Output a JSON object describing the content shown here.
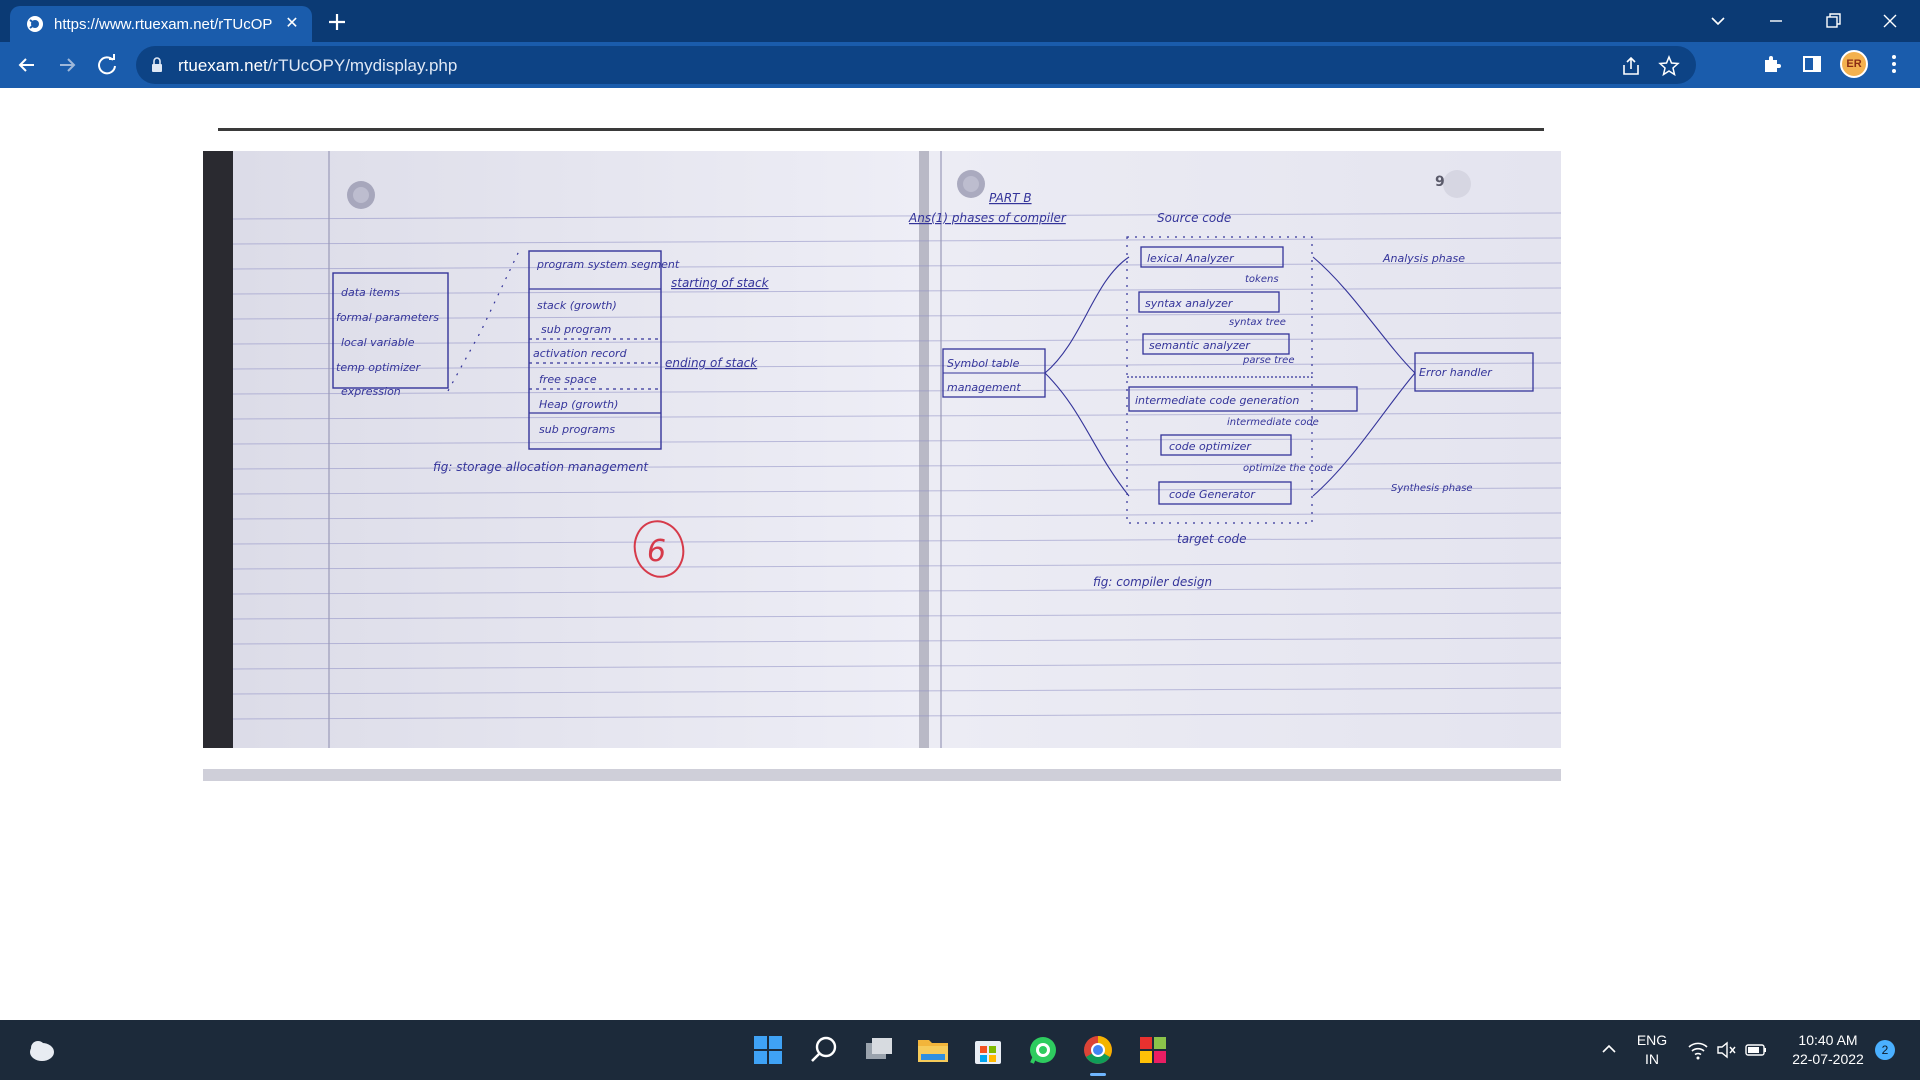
{
  "browser": {
    "tab": {
      "title": "https://www.rtuexam.net/rTUcOP",
      "close": "✕"
    },
    "address": {
      "host": "rtuexam.net",
      "path": "/rTUcOPY/mydisplay.php"
    }
  },
  "page": {
    "left_page": {
      "labels": {
        "left_box": [
          "data items",
          "formal parameters",
          "local variable",
          "temp optimizer",
          "expression"
        ],
        "stack_box": [
          "program system segment",
          "stack (growth)",
          "sub program",
          "activation record",
          "free space",
          "Heap (growth)",
          "sub programs"
        ],
        "start": "starting of stack",
        "end": "ending of stack",
        "caption": "fig: storage allocation management",
        "mark": "6"
      }
    },
    "right_page": {
      "page_number": "9",
      "part": "PART B",
      "answer": "Ans(1) phases of compiler",
      "source": "Source code",
      "boxes": [
        "lexical Analyzer",
        "syntax analyzer",
        "semantic analyzer",
        "intermediate code generation",
        "code optimizer",
        "code Generator"
      ],
      "flows": [
        "tokens",
        "syntax tree",
        "parse tree",
        "intermediate code",
        "optimize the code"
      ],
      "symbol": [
        "Symbol table",
        "management"
      ],
      "error": "Error handler",
      "analysis": "Analysis phase",
      "synthesis": "Synthesis phase",
      "target": "target code",
      "caption": "fig: compiler design"
    }
  },
  "taskbar": {
    "lang": "ENG",
    "region": "IN",
    "time": "10:40 AM",
    "date": "22-07-2022",
    "notifications": "2"
  },
  "colors": {
    "titlebar": "#0b3a74",
    "toolbar": "#1a5cac",
    "ink": "#34349a",
    "paper": "#e6e6f2",
    "taskbar": "#1c2a3a",
    "red_ink": "#d63a4a"
  },
  "icons": [
    "globe-icon",
    "plus-icon",
    "chevron-down-icon",
    "minimize-icon",
    "restore-icon",
    "close-icon",
    "back-icon",
    "forward-icon",
    "reload-icon",
    "lock-icon",
    "share-icon",
    "star-icon",
    "puzzle-icon",
    "sidepanel-icon",
    "menu-icon",
    "weather-icon",
    "start-icon",
    "search-icon",
    "taskview-icon",
    "explorer-icon",
    "store-icon",
    "whatsapp-icon",
    "chrome-icon",
    "app-icon",
    "chevron-up-icon",
    "wifi-icon",
    "volume-icon",
    "battery-icon"
  ]
}
